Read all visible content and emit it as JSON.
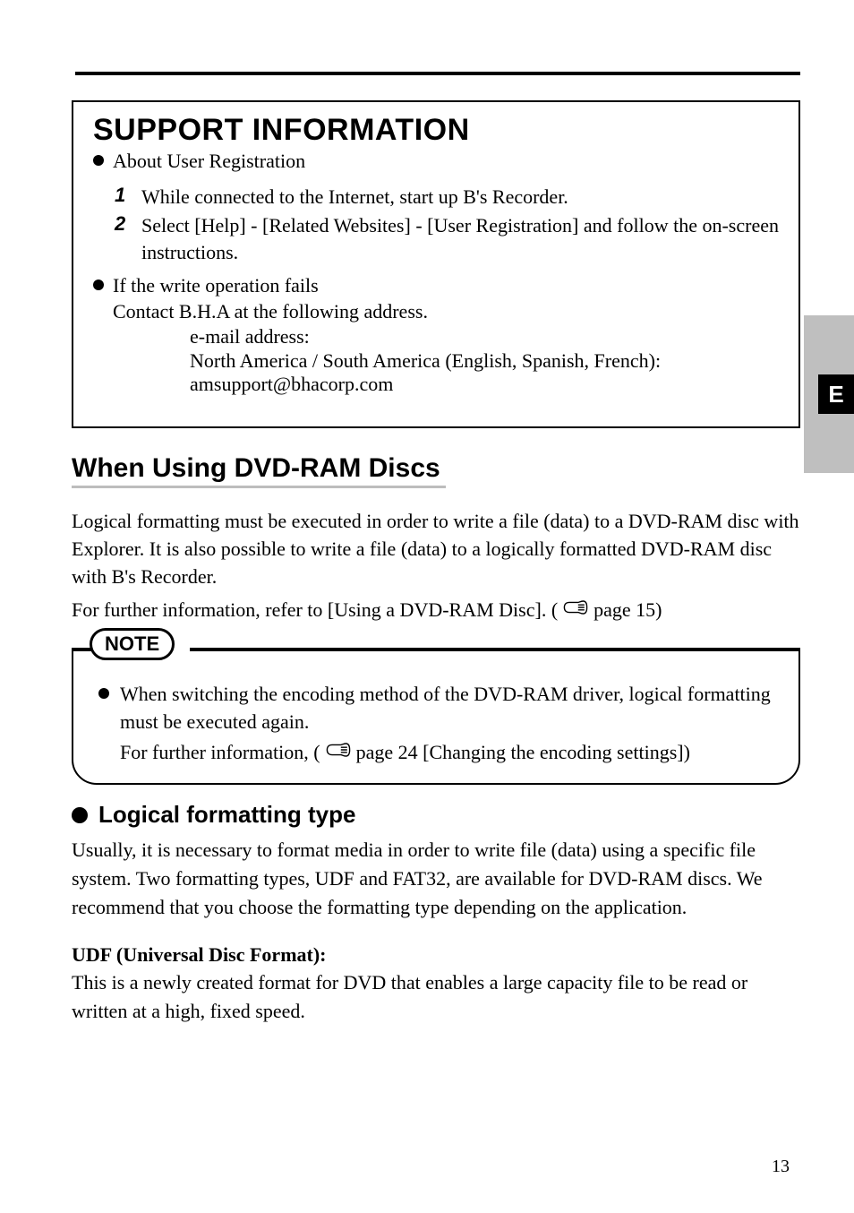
{
  "topRule": true,
  "supportBox": {
    "title": "SUPPORT INFORMATION",
    "bullet1": "About User Registration",
    "steps": [
      {
        "n": "1",
        "text": "While connected to the Internet, start up B's Recorder."
      },
      {
        "n": "2",
        "text": "Select [Help] - [Related Websites] - [User Registration] and follow the on-screen instructions."
      }
    ],
    "bullet2": "If the write operation fails",
    "bullet2_text": "Contact B.H.A at the following address.",
    "contact_heading": "e-mail address:",
    "contact_line1": "North America / South America (English, Spanish, French):",
    "contact_line2": "amsupport@bhacorp.com"
  },
  "section": {
    "heading": "When Using DVD-RAM Discs",
    "intro1": "Logical formatting must be executed in order to write a file (data) to a DVD-RAM disc with Explorer. It is also possible to write a file (data) to a logically formatted DVD-RAM disc with B's Recorder.",
    "intro2_pre": "For further information, refer to [Using a DVD-RAM Disc]. (",
    "intro2_post": " page 15)",
    "note_label": "NOTE",
    "note_bullet": "When switching the encoding method of the DVD-RAM driver, logical formatting must be executed again.",
    "note_sub_pre": "For further information, (",
    "note_sub_post": " page 24 [Changing the encoding settings])",
    "subheading": "Logical formatting type",
    "body": "Usually, it is necessary to format media in order to write file (data) using a specific file system. Two formatting types, UDF and FAT32, are available for DVD-RAM discs. We recommend that you choose the formatting type depending on the application.",
    "udf_label": "UDF (Universal Disc Format):",
    "udf_text": "This is a newly created format for DVD that enables a large capacity file to be read or written at a high, fixed speed."
  },
  "sideTab": "E",
  "pageNum": "13"
}
